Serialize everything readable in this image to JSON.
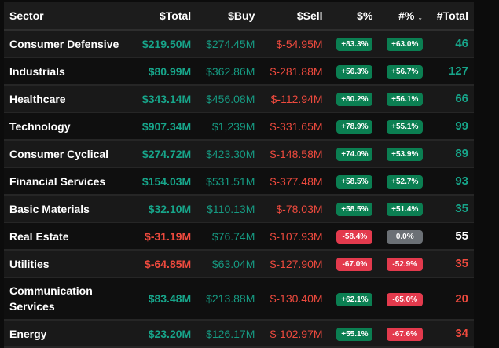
{
  "headers": [
    "Sector",
    "$Total",
    "$Buy",
    "$Sell",
    "$%",
    "#% ↓",
    "#Total"
  ],
  "rows": [
    {
      "sector": "Consumer Defensive",
      "total": "$219.50M",
      "buy": "$274.45M",
      "sell": "$-54.95M",
      "pct_dollar": "+83.3%",
      "pct_count": "+63.0%",
      "count": "46"
    },
    {
      "sector": "Industrials",
      "total": "$80.99M",
      "buy": "$362.86M",
      "sell": "$-281.88M",
      "pct_dollar": "+56.3%",
      "pct_count": "+56.7%",
      "count": "127"
    },
    {
      "sector": "Healthcare",
      "total": "$343.14M",
      "buy": "$456.08M",
      "sell": "$-112.94M",
      "pct_dollar": "+80.2%",
      "pct_count": "+56.1%",
      "count": "66"
    },
    {
      "sector": "Technology",
      "total": "$907.34M",
      "buy": "$1,239M",
      "sell": "$-331.65M",
      "pct_dollar": "+78.9%",
      "pct_count": "+55.1%",
      "count": "99"
    },
    {
      "sector": "Consumer Cyclical",
      "total": "$274.72M",
      "buy": "$423.30M",
      "sell": "$-148.58M",
      "pct_dollar": "+74.0%",
      "pct_count": "+53.9%",
      "count": "89"
    },
    {
      "sector": "Financial Services",
      "total": "$154.03M",
      "buy": "$531.51M",
      "sell": "$-377.48M",
      "pct_dollar": "+58.5%",
      "pct_count": "+52.7%",
      "count": "93"
    },
    {
      "sector": "Basic Materials",
      "total": "$32.10M",
      "buy": "$110.13M",
      "sell": "$-78.03M",
      "pct_dollar": "+58.5%",
      "pct_count": "+51.4%",
      "count": "35"
    },
    {
      "sector": "Real Estate",
      "total": "$-31.19M",
      "buy": "$76.74M",
      "sell": "$-107.93M",
      "pct_dollar": "-58.4%",
      "pct_count": "0.0%",
      "count": "55"
    },
    {
      "sector": "Utilities",
      "total": "$-64.85M",
      "buy": "$63.04M",
      "sell": "$-127.90M",
      "pct_dollar": "-67.0%",
      "pct_count": "-52.9%",
      "count": "35"
    },
    {
      "sector": "Communication Services",
      "total": "$83.48M",
      "buy": "$213.88M",
      "sell": "$-130.40M",
      "pct_dollar": "+62.1%",
      "pct_count": "-65.0%",
      "count": "20"
    },
    {
      "sector": "Energy",
      "total": "$23.20M",
      "buy": "$126.17M",
      "sell": "$-102.97M",
      "pct_dollar": "+55.1%",
      "pct_count": "-67.6%",
      "count": "34"
    }
  ]
}
